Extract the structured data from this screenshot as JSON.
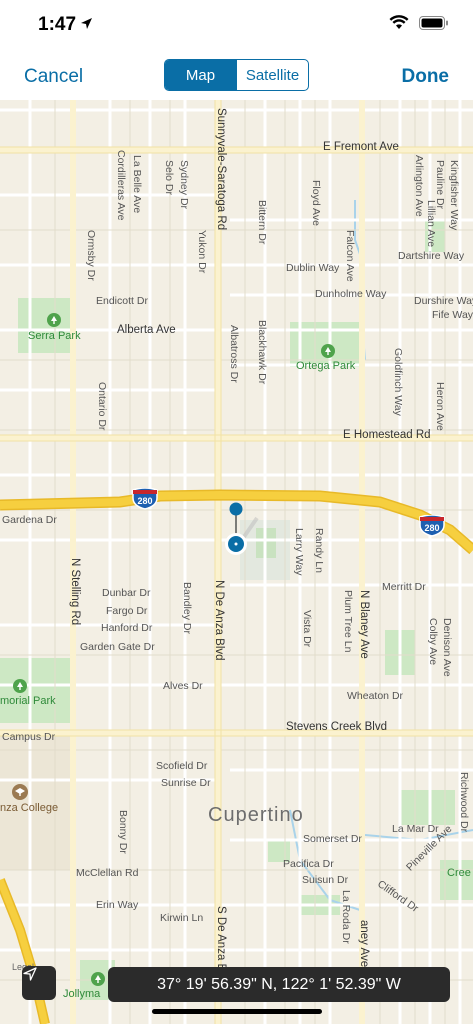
{
  "status": {
    "time": "1:47"
  },
  "nav": {
    "cancel": "Cancel",
    "done": "Done",
    "segments": {
      "map": "Map",
      "satellite": "Satellite"
    }
  },
  "map": {
    "city": "Cupertino",
    "roads": {
      "fremont": "E Fremont Ave",
      "homestead": "E Homestead Rd",
      "stevens_creek": "Stevens Creek Blvd",
      "mcclellan": "McClellan Rd",
      "alberta": "Alberta Ave",
      "sunnyvale_saratoga": "Sunnyvale-Saratoga Rd",
      "n_de_anza": "N De Anza Blvd",
      "s_de_anza": "S De Anza Bl",
      "n_stelling": "N Stelling Rd",
      "n_blaney": "N Blaney Ave",
      "blaney": "aney Ave",
      "cordilleras": "Cordilleras Ave",
      "la_belle": "La Belle Ave",
      "selo": "Selo Dr",
      "sydney": "Sydney Dr",
      "ormsby": "Ormsby Dr",
      "yukon": "Yukon Dr",
      "bittern": "Bittern Dr",
      "floyd": "Floyd Ave",
      "falcon": "Falcon Ave",
      "arlington": "Arlington Ave",
      "pauline": "Pauline Dr",
      "kingfisher": "Kingfisher Way",
      "lillian": "Lillian Ave",
      "dublin": "Dublin Way",
      "dartshire": "Dartshire Way",
      "dunholme": "Dunholme Way",
      "durshire": "Durshire Way",
      "fife": "Fife Way",
      "endicott": "Endicott Dr",
      "albatross": "Albatross Dr",
      "blackhawk": "Blackhawk Dr",
      "goldfinch": "Goldfinch Way",
      "heron": "Heron Ave",
      "ontario": "Ontario Dr",
      "gardena": "Gardena Dr",
      "larry": "Larry Way",
      "randy": "Randy Ln",
      "merritt": "Merritt Dr",
      "plum_tree": "Plum Tree Ln",
      "colby": "Colby Ave",
      "denison": "Denison Ave",
      "dunbar": "Dunbar Dr",
      "fargo": "Fargo Dr",
      "hanford": "Hanford Dr",
      "garden_gate": "Garden Gate Dr",
      "bandley": "Bandley Dr",
      "vista": "Vista Dr",
      "alves": "Alves Dr",
      "wheaton": "Wheaton Dr",
      "campus": "Campus Dr",
      "scofield": "Scofield Dr",
      "sunrise": "Sunrise Dr",
      "bonny": "Bonny Dr",
      "somerset": "Somerset Dr",
      "la_mar": "La Mar Dr",
      "richwood": "Richwood Dr",
      "pineville": "Pineville Ave",
      "pacifica": "Pacifica Dr",
      "suisun": "Suisun Dr",
      "la_roda": "La Roda Dr",
      "clifford": "Clifford Dr",
      "erin": "Erin Way",
      "kirwin": "Kirwin Ln"
    },
    "parks": {
      "serra": "Serra Park",
      "ortega": "Ortega Park",
      "memorial": "morial Park",
      "jollyman": "Jollyma",
      "creek": "Cree"
    },
    "poi": {
      "college": "nza College",
      "legal": "Legal"
    },
    "shields": {
      "i280": "280"
    }
  },
  "coordinates": "37° 19' 56.39\" N, 122° 1' 52.39\" W",
  "colors": {
    "accent": "#0a6ea6",
    "map_bg": "#f3efe4",
    "highway": "#f6cf3f",
    "park": "#cde8c4",
    "pin": "#0a6ea6"
  }
}
